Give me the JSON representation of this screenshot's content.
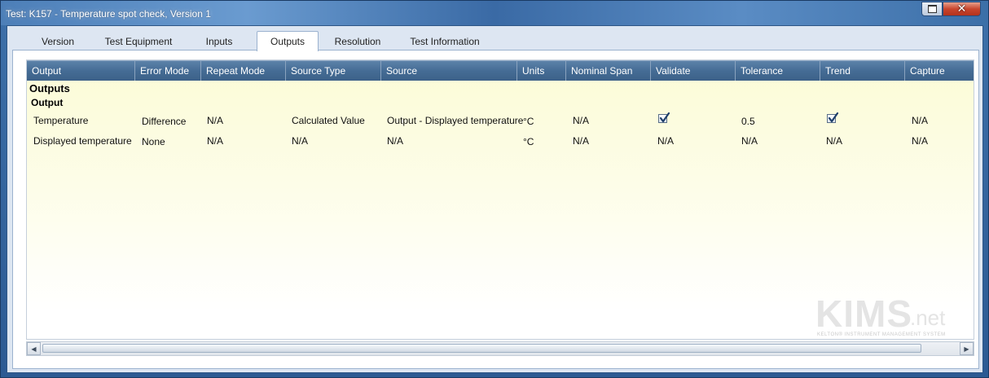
{
  "window": {
    "title": "Test: K157 - Temperature spot check, Version 1"
  },
  "tabs": [
    {
      "label": "Version"
    },
    {
      "label": "Test Equipment"
    },
    {
      "label": "Inputs"
    },
    {
      "label": "Outputs",
      "active": true
    },
    {
      "label": "Resolution"
    },
    {
      "label": "Test Information"
    }
  ],
  "grid": {
    "columns": [
      "Output",
      "Error Mode",
      "Repeat Mode",
      "Source Type",
      "Source",
      "Units",
      "Nominal Span",
      "Validate",
      "Tolerance",
      "Trend",
      "Capture"
    ],
    "group_title": "Outputs",
    "subgroup_title": "Output",
    "rows": [
      {
        "output": "Temperature",
        "error_mode": "Difference",
        "repeat_mode": "N/A",
        "source_type": "Calculated Value",
        "source": "Output - Displayed temperature",
        "units": "°C",
        "nominal_span": "N/A",
        "validate": true,
        "tolerance": "0.5",
        "trend": true,
        "capture": "N/A"
      },
      {
        "output": "Displayed temperature",
        "error_mode": "None",
        "repeat_mode": "N/A",
        "source_type": "N/A",
        "source": "N/A",
        "units": "°C",
        "nominal_span": "N/A",
        "validate": "N/A",
        "tolerance": "N/A",
        "trend": "N/A",
        "capture": "N/A"
      }
    ]
  },
  "logo": {
    "main": "KIMS",
    "suffix": ".net",
    "tagline": "KELTON® INSTRUMENT MANAGEMENT SYSTEM"
  },
  "colors": {
    "header": "#456c95",
    "grid_top": "#fbfbd6",
    "title_bar": "#3c6fa8",
    "close_button": "#c9452d"
  }
}
